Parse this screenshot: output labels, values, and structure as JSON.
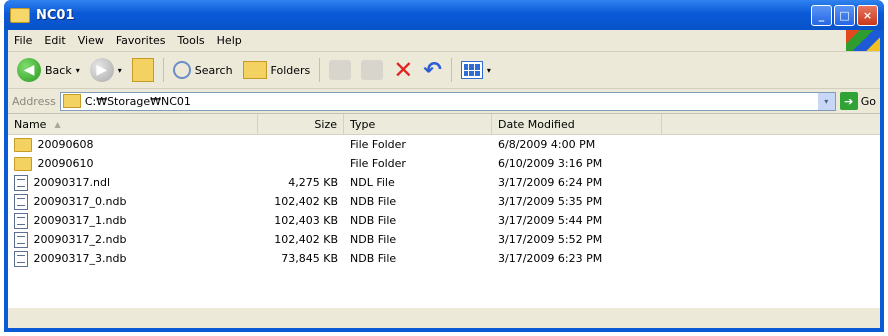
{
  "window": {
    "title": "NC01",
    "controls": {
      "minimize": "_",
      "maximize": "□",
      "close": "×"
    }
  },
  "menu": [
    "File",
    "Edit",
    "View",
    "Favorites",
    "Tools",
    "Help"
  ],
  "toolbar": {
    "back_label": "Back",
    "search_label": "Search",
    "folders_label": "Folders",
    "dropdown_glyph": "▾",
    "back_glyph": "◀",
    "forward_glyph": "▶",
    "delete_glyph": "✕",
    "undo_glyph": "↶"
  },
  "address": {
    "label": "Address",
    "value": "C:₩Storage₩NC01",
    "go_label": "Go",
    "go_glyph": "➔"
  },
  "columns": {
    "name": "Name",
    "size": "Size",
    "type": "Type",
    "date": "Date Modified",
    "sort_glyph": "▲"
  },
  "files": [
    {
      "name": "20090608",
      "size": "",
      "type": "File Folder",
      "date": "6/8/2009 4:00 PM",
      "icon": "folder-icon"
    },
    {
      "name": "20090610",
      "size": "",
      "type": "File Folder",
      "date": "6/10/2009 3:16 PM",
      "icon": "folder-icon"
    },
    {
      "name": "20090317.ndl",
      "size": "4,275 KB",
      "type": "NDL File",
      "date": "3/17/2009 6:24 PM",
      "icon": "file-icon"
    },
    {
      "name": "20090317_0.ndb",
      "size": "102,402 KB",
      "type": "NDB File",
      "date": "3/17/2009 5:35 PM",
      "icon": "file-icon"
    },
    {
      "name": "20090317_1.ndb",
      "size": "102,403 KB",
      "type": "NDB File",
      "date": "3/17/2009 5:44 PM",
      "icon": "file-icon"
    },
    {
      "name": "20090317_2.ndb",
      "size": "102,402 KB",
      "type": "NDB File",
      "date": "3/17/2009 5:52 PM",
      "icon": "file-icon"
    },
    {
      "name": "20090317_3.ndb",
      "size": "73,845 KB",
      "type": "NDB File",
      "date": "3/17/2009 6:23 PM",
      "icon": "file-icon"
    }
  ],
  "colors": {
    "titlebar": "#0b59d8",
    "chrome": "#ece9d8",
    "folder": "#f4d261"
  }
}
